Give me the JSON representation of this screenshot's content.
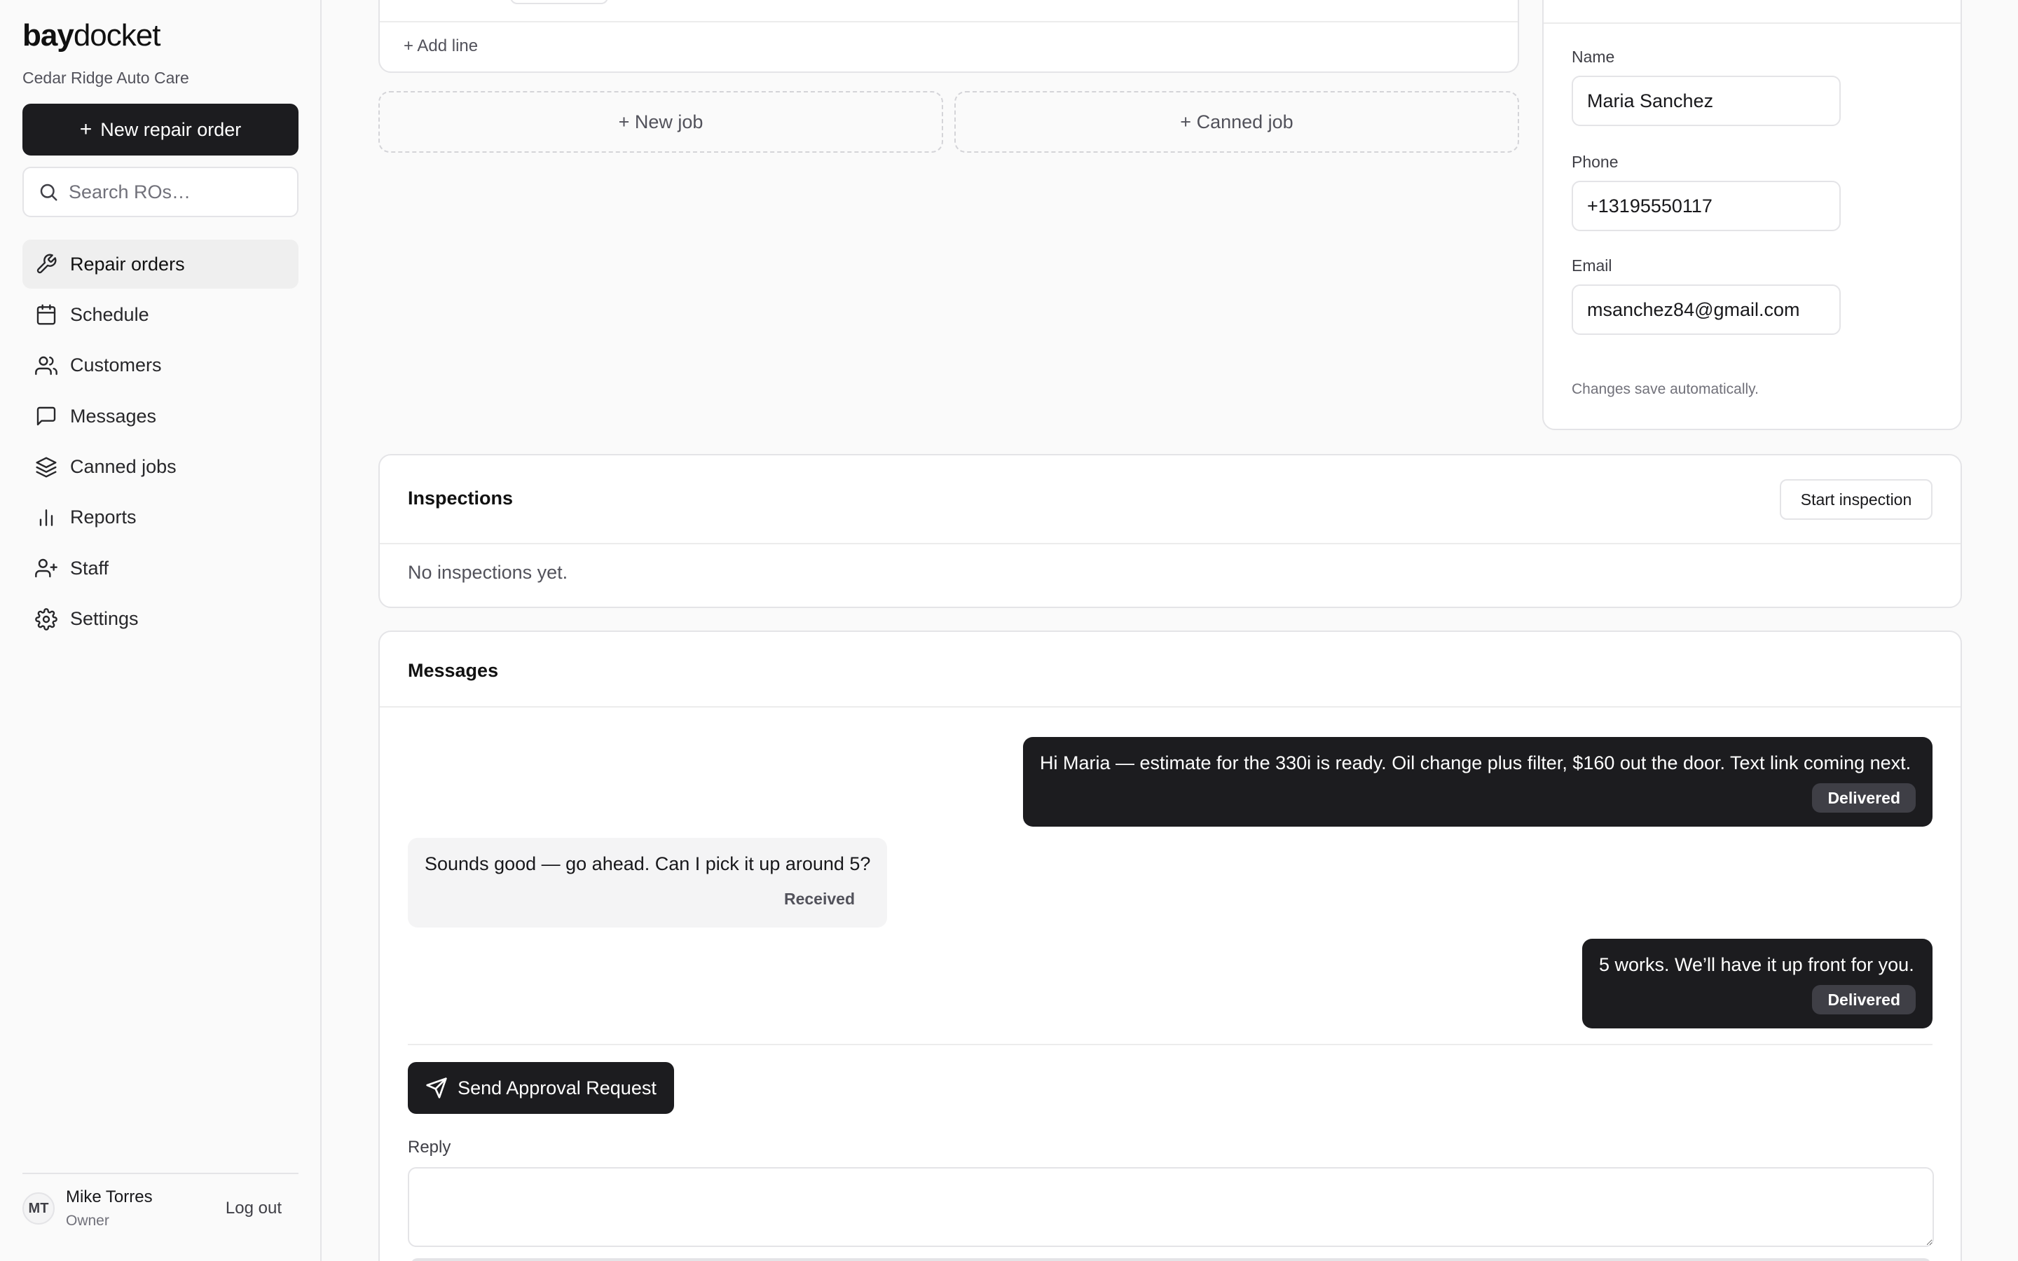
{
  "brand": {
    "bold": "bay",
    "light": "docket"
  },
  "shop_name": "Cedar Ridge Auto Care",
  "sidebar": {
    "new_ro_label": "New repair order",
    "search_placeholder": "Search ROs…",
    "items": [
      {
        "label": "Repair orders",
        "icon": "wrench-icon",
        "active": true
      },
      {
        "label": "Schedule",
        "icon": "calendar-icon"
      },
      {
        "label": "Customers",
        "icon": "users-icon"
      },
      {
        "label": "Messages",
        "icon": "message-square-icon"
      },
      {
        "label": "Canned jobs",
        "icon": "layers-icon"
      },
      {
        "label": "Reports",
        "icon": "bar-chart-icon"
      },
      {
        "label": "Staff",
        "icon": "user-plus-icon"
      },
      {
        "label": "Settings",
        "icon": "gear-icon"
      }
    ],
    "user": {
      "initials": "MT",
      "name": "Mike Torres",
      "role": "Owner",
      "logout_label": "Log out"
    }
  },
  "jobs": {
    "add_line_label": "+ Add line",
    "new_job_label": "+ New job",
    "canned_job_label": "+ Canned job"
  },
  "customer": {
    "name_label": "Name",
    "name_value": "Maria Sanchez",
    "phone_label": "Phone",
    "phone_value": "+13195550117",
    "email_label": "Email",
    "email_value": "msanchez84@gmail.com",
    "autosave_note": "Changes save automatically."
  },
  "inspections": {
    "title": "Inspections",
    "start_label": "Start inspection",
    "empty_text": "No inspections yet."
  },
  "messages": {
    "title": "Messages",
    "thread": [
      {
        "direction": "outgoing",
        "text": "Hi Maria — estimate for the 330i is ready. Oil change plus filter, $160 out the door. Text link coming next.",
        "status": "Delivered"
      },
      {
        "direction": "incoming",
        "text": "Sounds good — go ahead. Can I pick it up around 5?",
        "status": "Received"
      },
      {
        "direction": "outgoing",
        "text": "5 works. We’ll have it up front for you.",
        "status": "Delivered"
      }
    ],
    "send_approval_label": "Send Approval Request",
    "reply_label": "Reply",
    "reply_value": ""
  },
  "colors": {
    "primary": "#1c1c1f",
    "border": "#e4e4e7",
    "muted": "#52525b",
    "background": "#fafafa"
  }
}
